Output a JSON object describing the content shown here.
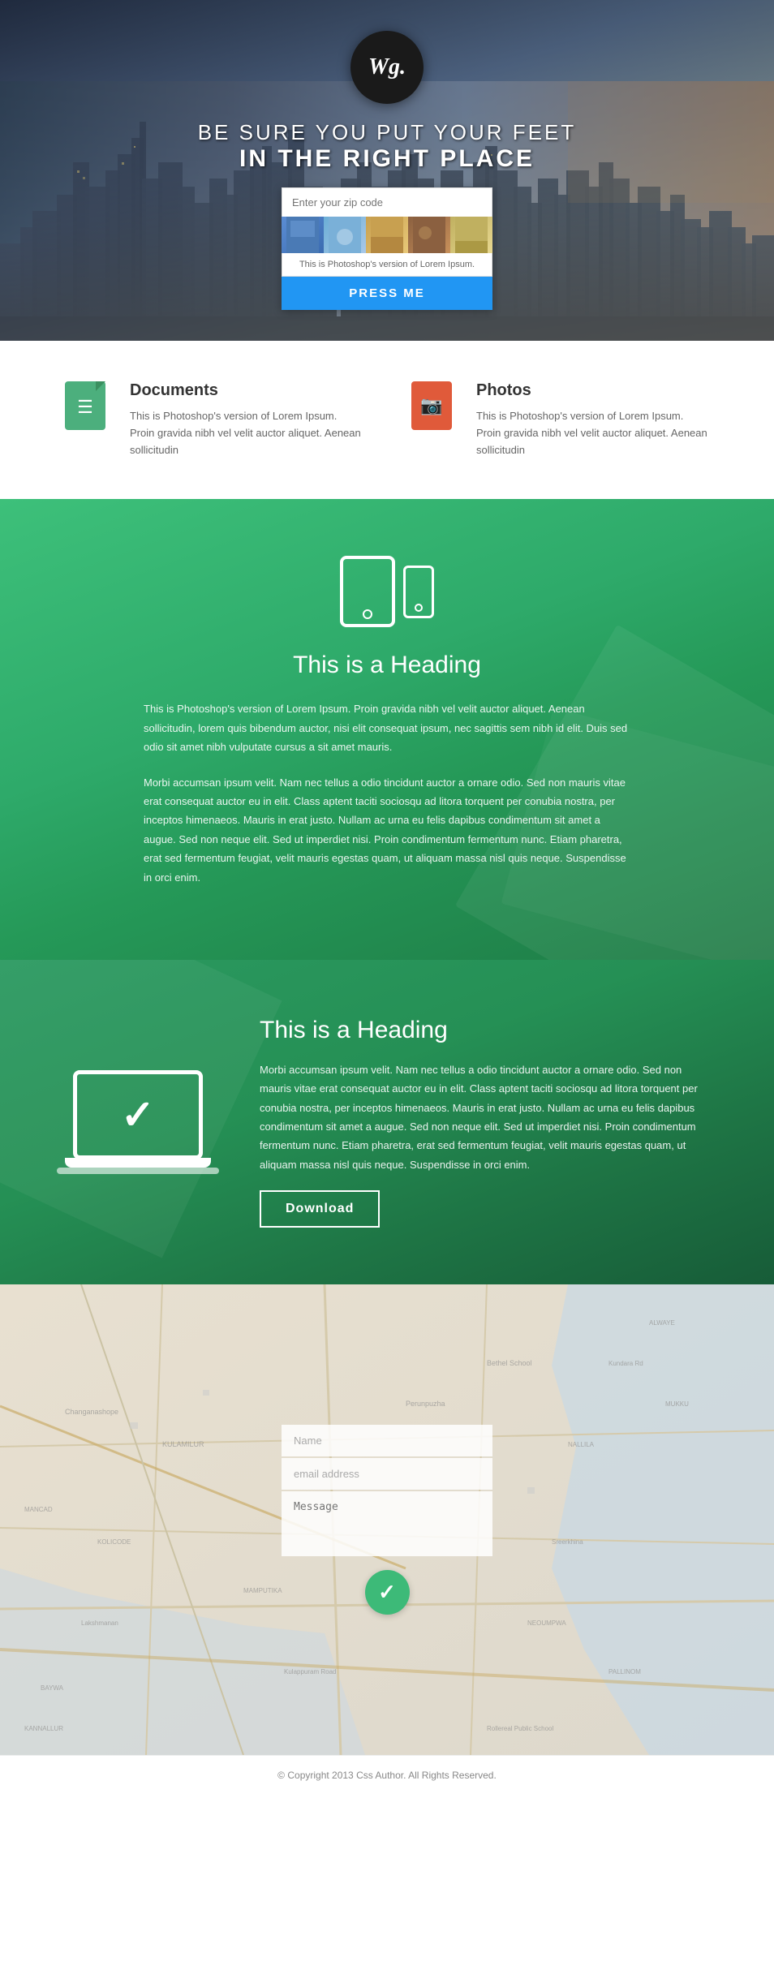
{
  "logo": {
    "text": "Wg."
  },
  "hero": {
    "tagline_line1": "BE SURE YOU PUT YOUR FEET",
    "tagline_line2": "IN THE RIGHT PLACE",
    "zip_placeholder": "Enter your zip code",
    "card_text": "This is Photoshop's version of Lorem Ipsum.",
    "press_button": "PRESS ME"
  },
  "features": [
    {
      "title": "Documents",
      "description": "This is Photoshop's version of Lorem Ipsum. Proin gravida nibh vel velit auctor aliquet. Aenean sollicitudin",
      "icon_type": "doc"
    },
    {
      "title": "Photos",
      "description": "This is Photoshop's version of Lorem Ipsum. Proin gravida nibh vel velit auctor aliquet. Aenean sollicitudin",
      "icon_type": "photo"
    }
  ],
  "green_section1": {
    "heading": "This is a Heading",
    "paragraph1": "This is Photoshop's version of Lorem Ipsum. Proin gravida nibh vel velit auctor aliquet. Aenean sollicitudin, lorem quis bibendum auctor, nisi elit consequat ipsum, nec sagittis sem nibh id elit. Duis sed odio sit amet nibh vulputate cursus a sit amet mauris.",
    "paragraph2": "Morbi accumsan ipsum velit. Nam nec tellus a odio tincidunt auctor a ornare odio. Sed non mauris vitae erat consequat auctor eu in elit. Class aptent taciti sociosqu ad litora torquent per conubia nostra, per inceptos himenaeos. Mauris in erat justo. Nullam ac urna eu felis dapibus condimentum sit amet a augue. Sed non neque elit. Sed ut imperdiet nisi. Proin condimentum fermentum nunc. Etiam pharetra, erat sed fermentum feugiat, velit mauris egestas quam, ut aliquam massa nisl quis neque. Suspendisse in orci enim."
  },
  "green_section2": {
    "heading": "This is a Heading",
    "paragraph": "Morbi accumsan ipsum velit. Nam nec tellus a odio tincidunt auctor a ornare odio. Sed non mauris vitae erat consequat auctor eu in elit. Class aptent taciti sociosqu ad litora torquent per conubia nostra, per inceptos himenaeos. Mauris in erat justo. Nullam ac urna eu felis dapibus condimentum sit amet a augue. Sed non neque elit. Sed ut imperdiet nisi. Proin condimentum fermentum nunc. Etiam pharetra, erat sed fermentum feugiat, velit mauris egestas quam, ut aliquam massa nisl quis neque. Suspendisse in orci enim.",
    "download_button": "Download"
  },
  "contact": {
    "name_placeholder": "Name",
    "email_placeholder": "email address",
    "message_placeholder": "Message"
  },
  "footer": {
    "copyright": "© Copyright 2013 Css Author. All Rights Reserved."
  },
  "colors": {
    "green_primary": "#3dba78",
    "green_dark": "#259055",
    "blue_button": "#2196F3",
    "doc_green": "#4caf7d",
    "photo_red": "#e05a3a"
  }
}
